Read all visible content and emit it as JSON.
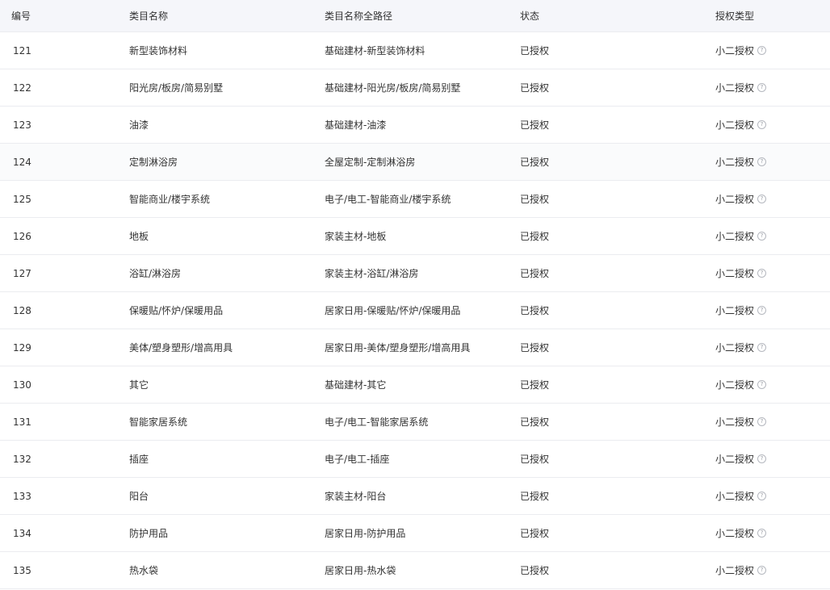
{
  "table": {
    "headers": {
      "id": "编号",
      "name": "类目名称",
      "path": "类目名称全路径",
      "status": "状态",
      "auth_type": "授权类型"
    },
    "help_icon_glyph": "?",
    "rows": [
      {
        "id": "121",
        "name": "新型装饰材料",
        "path": "基础建材-新型装饰材料",
        "status": "已授权",
        "auth_type": "小二授权"
      },
      {
        "id": "122",
        "name": "阳光房/板房/简易别墅",
        "path": "基础建材-阳光房/板房/简易别墅",
        "status": "已授权",
        "auth_type": "小二授权"
      },
      {
        "id": "123",
        "name": "油漆",
        "path": "基础建材-油漆",
        "status": "已授权",
        "auth_type": "小二授权"
      },
      {
        "id": "124",
        "name": "定制淋浴房",
        "path": "全屋定制-定制淋浴房",
        "status": "已授权",
        "auth_type": "小二授权"
      },
      {
        "id": "125",
        "name": "智能商业/楼宇系统",
        "path": "电子/电工-智能商业/楼宇系统",
        "status": "已授权",
        "auth_type": "小二授权"
      },
      {
        "id": "126",
        "name": "地板",
        "path": "家装主材-地板",
        "status": "已授权",
        "auth_type": "小二授权"
      },
      {
        "id": "127",
        "name": "浴缸/淋浴房",
        "path": "家装主材-浴缸/淋浴房",
        "status": "已授权",
        "auth_type": "小二授权"
      },
      {
        "id": "128",
        "name": "保暖贴/怀炉/保暖用品",
        "path": "居家日用-保暖贴/怀炉/保暖用品",
        "status": "已授权",
        "auth_type": "小二授权"
      },
      {
        "id": "129",
        "name": "美体/塑身塑形/增高用具",
        "path": "居家日用-美体/塑身塑形/增高用具",
        "status": "已授权",
        "auth_type": "小二授权"
      },
      {
        "id": "130",
        "name": "其它",
        "path": "基础建材-其它",
        "status": "已授权",
        "auth_type": "小二授权"
      },
      {
        "id": "131",
        "name": "智能家居系统",
        "path": "电子/电工-智能家居系统",
        "status": "已授权",
        "auth_type": "小二授权"
      },
      {
        "id": "132",
        "name": "插座",
        "path": "电子/电工-插座",
        "status": "已授权",
        "auth_type": "小二授权"
      },
      {
        "id": "133",
        "name": "阳台",
        "path": "家装主材-阳台",
        "status": "已授权",
        "auth_type": "小二授权"
      },
      {
        "id": "134",
        "name": "防护用品",
        "path": "居家日用-防护用品",
        "status": "已授权",
        "auth_type": "小二授权"
      },
      {
        "id": "135",
        "name": "热水袋",
        "path": "居家日用-热水袋",
        "status": "已授权",
        "auth_type": "小二授权"
      }
    ],
    "highlighted_row_index": 3
  }
}
